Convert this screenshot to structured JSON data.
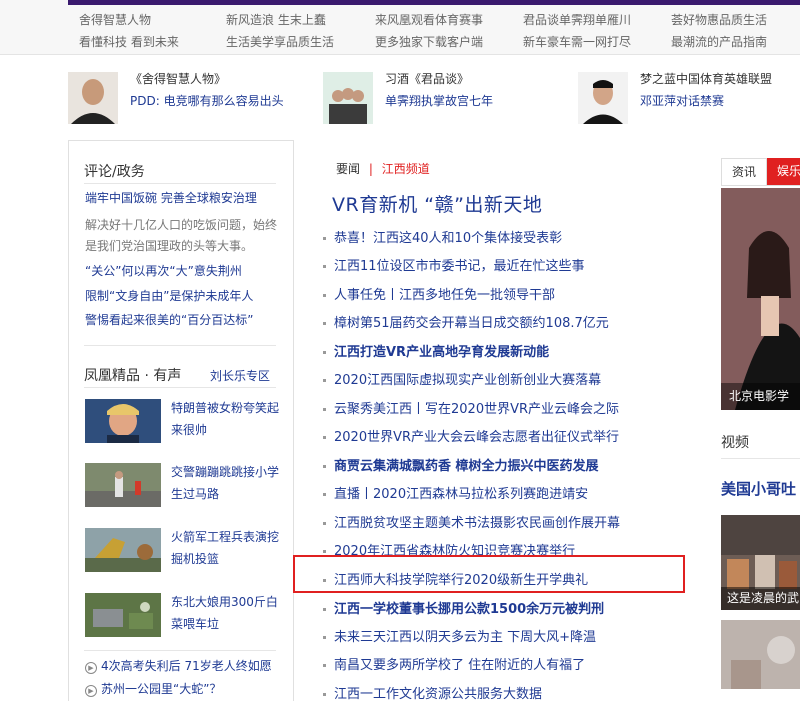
{
  "topbar": {
    "row1": [
      "舍得智慧人物",
      "新风造浪 生末上蠢",
      "来风凰观看体育赛事",
      "君品谈单霁翔单雁川",
      "荟好物惠品质生活"
    ],
    "row2": [
      "看懂科技 看到未来",
      "生活美学享品质生活",
      "更多独家下载客户端",
      "新车豪车需一网打尽",
      "最潮流的产品指南"
    ]
  },
  "people": [
    {
      "title": "《舍得智慧人物》",
      "sub": "PDD: 电竞哪有那么容易出头"
    },
    {
      "title": "习酒《君品谈》",
      "sub": "单霁翔执掌故宫七年"
    },
    {
      "title": "梦之蓝中国体育英雄联盟",
      "sub": "邓亚萍对话禁赛"
    }
  ],
  "left": {
    "section1_title": "评论/政务",
    "s1_link": "端牢中国饭碗 完善全球粮安治理",
    "s1_text": "解决好十几亿人口的吃饭问题，始终是我们党治国理政的头等大事。",
    "s1_links": [
      "“关公”何以再次“大”意失荆州",
      "限制“文身自由”是保护未成年人",
      "警惕看起来很美的“百分百达标”"
    ],
    "section2_title": "凤凰精品 · 有声",
    "section2_more": "刘长乐专区",
    "thumbs": [
      {
        "text": "特朗普被女粉夸笑起来很帅"
      },
      {
        "text": "交警蹦蹦跳跳接小学生过马路"
      },
      {
        "text": "火箭军工程兵表演挖掘机投篮"
      },
      {
        "text": "东北大娘用300斤白菜喂车垃"
      }
    ],
    "bottom_items": [
      "4次高考失利后 71岁老人终如愿",
      "苏州一公园里“大蛇”？"
    ]
  },
  "center": {
    "tab_news": "要闻",
    "tab_sep": "|",
    "tab_channel": "江西频道",
    "headline": "VR育新机 “赣”出新天地",
    "items": [
      {
        "text": "恭喜！江西这40人和10个集体接受表彰",
        "bold": false
      },
      {
        "text": "江西11位设区市市委书记，最近在忙这些事",
        "bold": false
      },
      {
        "text": "人事任免丨江西多地任免一批领导干部",
        "bold": false
      },
      {
        "text": "樟树第51届药交会开幕当日成交额约108.7亿元",
        "bold": false
      },
      {
        "text": "江西打造VR产业高地孕育发展新动能",
        "bold": true
      },
      {
        "text": "2020江西国际虚拟现实产业创新创业大赛落幕",
        "bold": false
      },
      {
        "text": "云聚秀美江西丨写在2020世界VR产业云峰会之际",
        "bold": false
      },
      {
        "text": "2020世界VR产业大会云峰会志愿者出征仪式举行",
        "bold": false
      },
      {
        "text": "商贾云集满城飘药香 樟树全力振兴中医药发展",
        "bold": true
      },
      {
        "text": "直播丨2020江西森林马拉松系列赛跑进靖安",
        "bold": false
      },
      {
        "text": "江西脱贫攻坚主题美术书法摄影农民画创作展开幕",
        "bold": false
      },
      {
        "text": "2020年江西省森林防火知识竞赛决赛举行",
        "bold": false
      },
      {
        "text": "江西师大科技学院举行2020级新生开学典礼",
        "bold": false
      },
      {
        "text": "江西一学校董事长挪用公款1500余万元被判刑",
        "bold": true
      },
      {
        "text": "未来三天江西以阴天多云为主 下周大风+降温",
        "bold": false
      },
      {
        "text": "南昌又要多两所学校了 住在附近的人有福了",
        "bold": false
      },
      {
        "text": "江西一工作文化资源公共服务大数据",
        "bold": false
      }
    ],
    "highlight_color": "#e02020"
  },
  "right": {
    "tab1": "资讯",
    "tab2": "娱乐",
    "pic_caption": "北京电影学",
    "video_title": "视频",
    "video_headline": "美国小哥吐",
    "video_caption": "这是凌晨的武"
  }
}
